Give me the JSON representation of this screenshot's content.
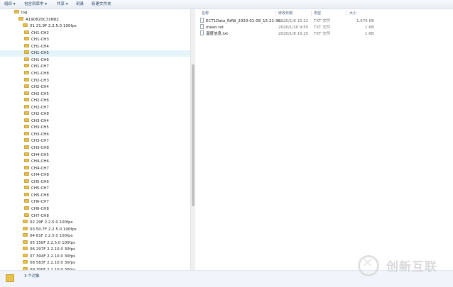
{
  "toolbar": {
    "organize": "组织 ▾",
    "include_in_library": "包含到库中 ▾",
    "share": "共享 ▾",
    "burn": "刻录",
    "new_folder": "新建文件夹"
  },
  "tree": [
    {
      "label": "log",
      "indent": 0
    },
    {
      "label": "A190820C31N82",
      "indent": 1
    },
    {
      "label": "01  21.9F     2.2.5.0   100fps",
      "indent": 2
    },
    {
      "label": "CH1-CH2",
      "indent": 3
    },
    {
      "label": "CH1-CH3",
      "indent": 3
    },
    {
      "label": "CH1-CH4",
      "indent": 3
    },
    {
      "label": "CH1-CH5",
      "indent": 3,
      "selected": true
    },
    {
      "label": "CH1-CH6",
      "indent": 3
    },
    {
      "label": "CH1-CH7",
      "indent": 3
    },
    {
      "label": "CH1-CH8",
      "indent": 3
    },
    {
      "label": "CH2-CH3",
      "indent": 3
    },
    {
      "label": "CH2-CH4",
      "indent": 3
    },
    {
      "label": "CH2-CH5",
      "indent": 3
    },
    {
      "label": "CH2-CH6",
      "indent": 3
    },
    {
      "label": "CH2-CH7",
      "indent": 3
    },
    {
      "label": "CH2-CH8",
      "indent": 3
    },
    {
      "label": "CH3-CH4",
      "indent": 3
    },
    {
      "label": "CH3-CH5",
      "indent": 3
    },
    {
      "label": "CH3-CH6",
      "indent": 3
    },
    {
      "label": "CH3-CH7",
      "indent": 3
    },
    {
      "label": "CH3-CH8",
      "indent": 3
    },
    {
      "label": "CH4-CH5",
      "indent": 3
    },
    {
      "label": "CH4-CH6",
      "indent": 3
    },
    {
      "label": "CH4-CH7",
      "indent": 3
    },
    {
      "label": "CH4-CH8",
      "indent": 3
    },
    {
      "label": "CH5-CH6",
      "indent": 3
    },
    {
      "label": "CH5-CH7",
      "indent": 3
    },
    {
      "label": "CH5-CH8",
      "indent": 3
    },
    {
      "label": "CH6-CH7",
      "indent": 3
    },
    {
      "label": "CH6-CH8",
      "indent": 3
    },
    {
      "label": "CH7-CH8",
      "indent": 3
    },
    {
      "label": "02  29F       2.2.5.0   100fps",
      "indent": 2
    },
    {
      "label": "03  50.7F     2.2.5.0   100fps",
      "indent": 2
    },
    {
      "label": "04  81F       2.2.5.0   100fps",
      "indent": 2
    },
    {
      "label": "05  150F      2.2.5.0   100fps",
      "indent": 2
    },
    {
      "label": "06  297F      2.2.10.0   30fps",
      "indent": 2
    },
    {
      "label": "07  394F      2.2.10.0   30fps",
      "indent": 2
    },
    {
      "label": "08  583F      2.2.10.0   30fps",
      "indent": 2
    },
    {
      "label": "09  700F      2.2.10.0   30fps",
      "indent": 2
    }
  ],
  "columns": {
    "name": "名称",
    "date": "修改日期",
    "type": "类型",
    "size": "大小"
  },
  "files": [
    {
      "name": "ECT1Data_RAW_2020-01-08_15-21-36...",
      "date": "2020/1/8 15:22",
      "type": "TXT 文件",
      "size": "1,676 KB"
    },
    {
      "name": "mean.txt",
      "date": "2020/1/10 9:55",
      "type": "TXT 文件",
      "size": "1 KB"
    },
    {
      "name": "温度信息.txt",
      "date": "2020/1/8 15:25",
      "type": "TXT 文件",
      "size": "1 KB"
    }
  ],
  "status": {
    "count": "3 个对象"
  },
  "watermark": {
    "text": "创新互联"
  },
  "colors": {
    "folder": "#e8c14d",
    "selection": "#e5f3fb",
    "toolbar_text": "#1e395b"
  }
}
